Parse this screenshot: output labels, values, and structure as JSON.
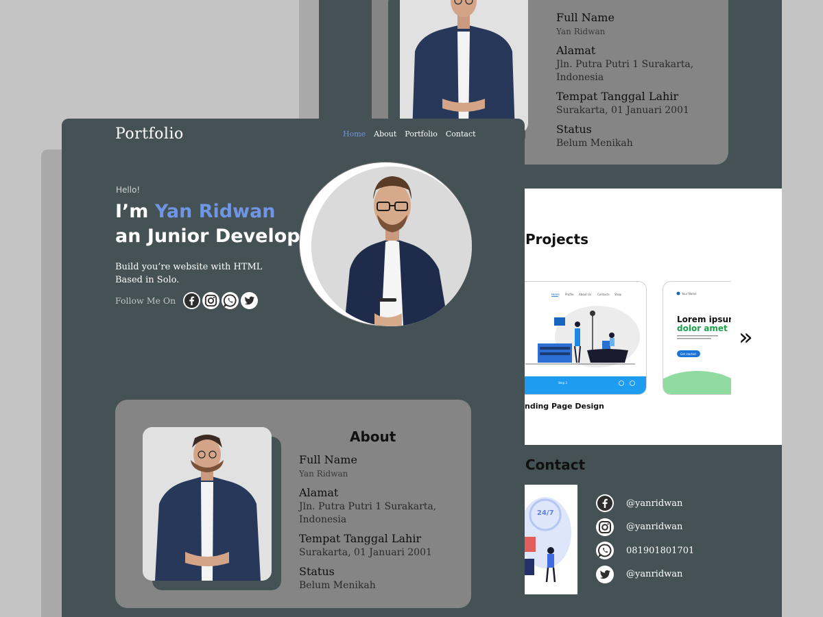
{
  "colors": {
    "bg": "#c4c4c4",
    "card": "#455255",
    "panel": "#858585",
    "accent": "#6f95e3"
  },
  "brand": {
    "logo": "Portfolio"
  },
  "nav": [
    {
      "label": "Home",
      "active": true
    },
    {
      "label": "About"
    },
    {
      "label": "Portfolio"
    },
    {
      "label": "Contact"
    }
  ],
  "hero": {
    "greeting": "Hello!",
    "intro_prefix": "I’m ",
    "name": "Yan Ridwan",
    "role_line": "an Junior Developer",
    "description_line1": "Build you’re website with HTML",
    "description_line2": "Based in Solo.",
    "follow_label": "Follow Me On",
    "social_icons": [
      "facebook-icon",
      "instagram-icon",
      "whatsapp-icon",
      "twitter-icon"
    ]
  },
  "about": {
    "title": "About",
    "fields": [
      {
        "label": "Full Name",
        "value": "Yan Ridwan"
      },
      {
        "label": "Alamat",
        "value_line1": "Jln. Putra Putri 1 Surakarta,",
        "value_line2": "Indonesia"
      },
      {
        "label": "Tempat Tanggal Lahir",
        "value": "Surakarta, 01 Januari 2001"
      },
      {
        "label": "Status",
        "value": "Belum Menikah"
      }
    ]
  },
  "projects": {
    "title": "Projects",
    "caption": "nding Page Design",
    "card1": {
      "nav": [
        "Home",
        "Profile",
        "About Us",
        "Contacts",
        "Shop"
      ],
      "footer": "Step 3"
    },
    "card2": {
      "brand": "Your Name",
      "heading_line1": "Lorem ipsum",
      "heading_line2": "dolor amet",
      "button": "Get started"
    }
  },
  "contact": {
    "title": "Contact",
    "badge": "24/7",
    "items": [
      {
        "icon": "facebook-icon",
        "text": "@yanridwan"
      },
      {
        "icon": "instagram-icon",
        "text": "@yanridwan"
      },
      {
        "icon": "whatsapp-icon",
        "text": "081901801701"
      },
      {
        "icon": "twitter-icon",
        "text": "@yanridwan"
      }
    ]
  }
}
